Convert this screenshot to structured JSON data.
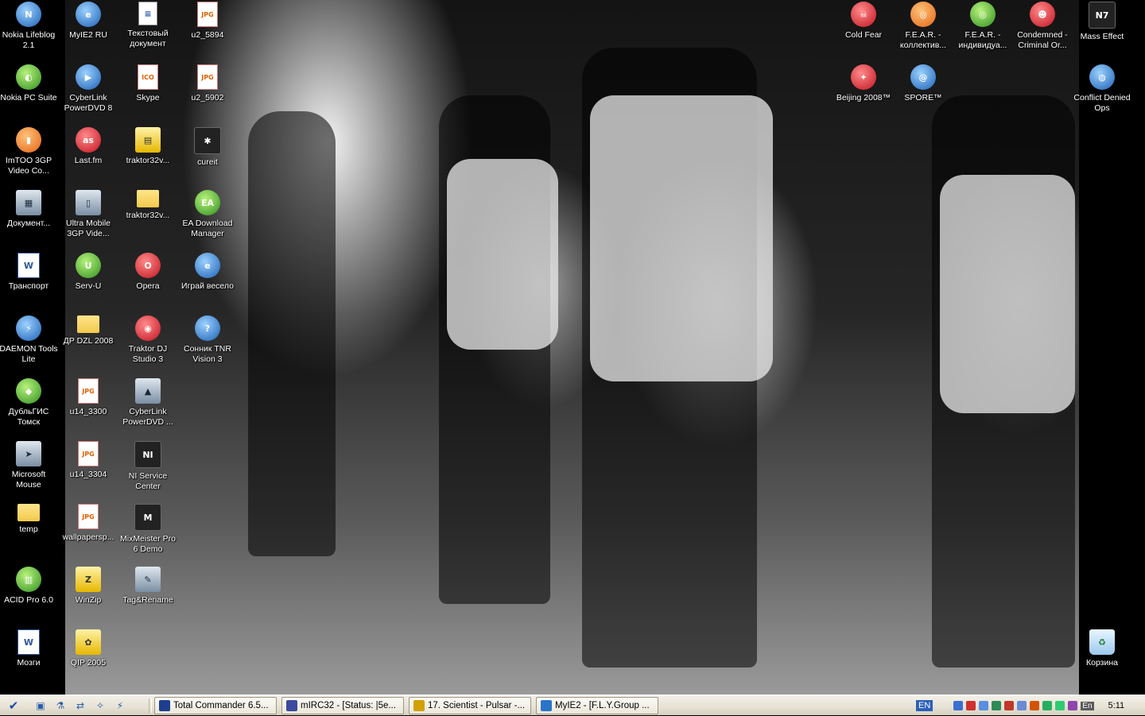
{
  "desktop": {
    "icons_left": [
      {
        "label": "Nokia Lifeblog 2.1",
        "icon": "nokia-lifeblog-icon",
        "glyph": "N",
        "style": "i-blue"
      },
      {
        "label": "MyIE2 RU",
        "icon": "myie2-icon",
        "glyph": "e",
        "style": "i-blue"
      },
      {
        "label": "Текстовый документ",
        "icon": "text-document-icon",
        "glyph": "≡",
        "style": "i-doc"
      },
      {
        "label": "u2_5894",
        "icon": "jpg-file-icon",
        "glyph": "JPG",
        "style": "i-jpg"
      },
      {
        "label": "Nokia PC Suite",
        "icon": "nokia-pc-suite-icon",
        "glyph": "◐",
        "style": "i-green"
      },
      {
        "label": "CyberLink PowerDVD 8",
        "icon": "powerdvd-icon",
        "glyph": "▶",
        "style": "i-blue"
      },
      {
        "label": "Skype",
        "icon": "skype-icon",
        "glyph": "ICO",
        "style": "i-jpg"
      },
      {
        "label": "u2_5902",
        "icon": "jpg-file-icon",
        "glyph": "JPG",
        "style": "i-jpg"
      },
      {
        "label": "ImTOO 3GP Video Co...",
        "icon": "imtoo-3gp-icon",
        "glyph": "▮",
        "style": "i-orange"
      },
      {
        "label": "Last.fm",
        "icon": "lastfm-icon",
        "glyph": "as",
        "style": "i-red"
      },
      {
        "label": "traktor32v...",
        "icon": "traktor-archive-icon",
        "glyph": "▤",
        "style": "i-yellow"
      },
      {
        "label": "cureit",
        "icon": "cureit-spider-icon",
        "glyph": "✱",
        "style": "i-dark"
      },
      {
        "label": "Документ...",
        "icon": "winrar-archive-icon",
        "glyph": "▦",
        "style": "i-gray"
      },
      {
        "label": "Ultra Mobile 3GP Vide...",
        "icon": "ultra-mobile-3gp-icon",
        "glyph": "▯",
        "style": "i-gray"
      },
      {
        "label": "traktor32v...",
        "icon": "folder-icon",
        "glyph": "",
        "style": "i-folder"
      },
      {
        "label": "EA Download Manager",
        "icon": "ea-download-manager-icon",
        "glyph": "EA",
        "style": "i-green"
      },
      {
        "label": "Транспорт",
        "icon": "word-document-icon",
        "glyph": "W",
        "style": "i-word"
      },
      {
        "label": "Serv-U",
        "icon": "serv-u-icon",
        "glyph": "U",
        "style": "i-green"
      },
      {
        "label": "Opera",
        "icon": "opera-icon",
        "glyph": "O",
        "style": "i-red"
      },
      {
        "label": "Играй весело",
        "icon": "internet-explorer-icon",
        "glyph": "e",
        "style": "i-blue"
      },
      {
        "label": "DAEMON Tools Lite",
        "icon": "daemon-tools-icon",
        "glyph": "⚡",
        "style": "i-blue"
      },
      {
        "label": "ДР DZL 2008",
        "icon": "folder-icon",
        "glyph": "",
        "style": "i-folder"
      },
      {
        "label": "Traktor DJ Studio 3",
        "icon": "traktor-dj-icon",
        "glyph": "◉",
        "style": "i-red"
      },
      {
        "label": "Сонник TNR Vision 3",
        "icon": "sonnik-icon",
        "glyph": "?",
        "style": "i-blue"
      },
      {
        "label": "ДубльГИС Томск",
        "icon": "doublegis-icon",
        "glyph": "◆",
        "style": "i-green"
      },
      {
        "label": "u14_3300",
        "icon": "jpg-file-icon",
        "glyph": "JPG",
        "style": "i-jpg"
      },
      {
        "label": "CyberLink PowerDVD ...",
        "icon": "powerdvd-alt-icon",
        "glyph": "▲",
        "style": "i-gray"
      },
      {
        "label": "Microsoft Mouse",
        "icon": "mouse-pointer-icon",
        "glyph": "➤",
        "style": "i-gray"
      },
      {
        "label": "u14_3304",
        "icon": "jpg-file-icon",
        "glyph": "JPG",
        "style": "i-jpg"
      },
      {
        "label": "NI Service Center",
        "icon": "ni-service-center-icon",
        "glyph": "NI",
        "style": "i-dark"
      },
      {
        "label": "temp",
        "icon": "folder-icon",
        "glyph": "",
        "style": "i-folder"
      },
      {
        "label": "wallpapersp...",
        "icon": "jpg-file-icon",
        "glyph": "JPG",
        "style": "i-jpg"
      },
      {
        "label": "MixMeister Pro 6 Demo",
        "icon": "mixmeister-icon",
        "glyph": "M",
        "style": "i-dark"
      },
      {
        "label": "ACID Pro 6.0",
        "icon": "acid-pro-icon",
        "glyph": "▥",
        "style": "i-green"
      },
      {
        "label": "WinZip",
        "icon": "winzip-icon",
        "glyph": "Z",
        "style": "i-yellow"
      },
      {
        "label": "Tag&Rename",
        "icon": "tag-rename-icon",
        "glyph": "✎",
        "style": "i-gray"
      },
      {
        "label": "Мозги",
        "icon": "word-document-icon",
        "glyph": "W",
        "style": "i-word"
      },
      {
        "label": "QIP 2005",
        "icon": "qip-icon",
        "glyph": "✿",
        "style": "i-yellow"
      }
    ],
    "icons_right": [
      {
        "label": "Cold Fear",
        "icon": "cold-fear-icon",
        "glyph": "☠",
        "style": "i-red"
      },
      {
        "label": "F.E.A.R. - коллектив...",
        "icon": "fear-multiplayer-icon",
        "glyph": "◎",
        "style": "i-orange"
      },
      {
        "label": "F.E.A.R. - индивидуа...",
        "icon": "fear-singleplayer-icon",
        "glyph": "◎",
        "style": "i-green"
      },
      {
        "label": "Condemned - Criminal Or...",
        "icon": "condemned-icon",
        "glyph": "☻",
        "style": "i-red"
      },
      {
        "label": "Mass Effect",
        "icon": "mass-effect-icon",
        "glyph": "N7",
        "style": "i-dark"
      },
      {
        "label": "Beijing 2008™",
        "icon": "beijing-2008-icon",
        "glyph": "✦",
        "style": "i-red"
      },
      {
        "label": "SPORE™",
        "icon": "spore-icon",
        "glyph": "@",
        "style": "i-blue"
      },
      {
        "label": "Conflict Denied Ops",
        "icon": "conflict-denied-ops-icon",
        "glyph": "◍",
        "style": "i-blue"
      },
      {
        "label": "Корзина",
        "icon": "recycle-bin-icon",
        "glyph": "♻",
        "style": "i-recycle"
      }
    ]
  },
  "taskbar": {
    "start_glyph": "✔",
    "quick_launch": [
      {
        "icon": "show-desktop-icon",
        "glyph": "▣"
      },
      {
        "icon": "microscope-icon",
        "glyph": "⚗"
      },
      {
        "icon": "network-icon",
        "glyph": "⇄"
      },
      {
        "icon": "lamp-icon",
        "glyph": "✧"
      },
      {
        "icon": "winamp-icon",
        "glyph": "⚡"
      }
    ],
    "tasks": [
      {
        "label": "Total Commander 6.5...",
        "icon": "total-commander-icon",
        "color": "#1e3f8f"
      },
      {
        "label": "mIRC32 - [Status: |5e...",
        "icon": "mirc-icon",
        "color": "#3b4a9f"
      },
      {
        "label": "17. Scientist - Pulsar -...",
        "icon": "winamp-icon",
        "color": "#d1a100"
      },
      {
        "label": "MyIE2 - [F.L.Y.Group ...",
        "icon": "myie2-icon",
        "color": "#2a74c9"
      }
    ],
    "tray": {
      "language": "EN",
      "language2": "En",
      "clock": "5:11",
      "icons": [
        "#3b6fd1",
        "#d03030",
        "#5a8ee0",
        "#2e8b57",
        "#c0392b",
        "#6a8ad6",
        "#d35400",
        "#27ae60",
        "#2ecc71",
        "#8e44ad"
      ]
    }
  }
}
